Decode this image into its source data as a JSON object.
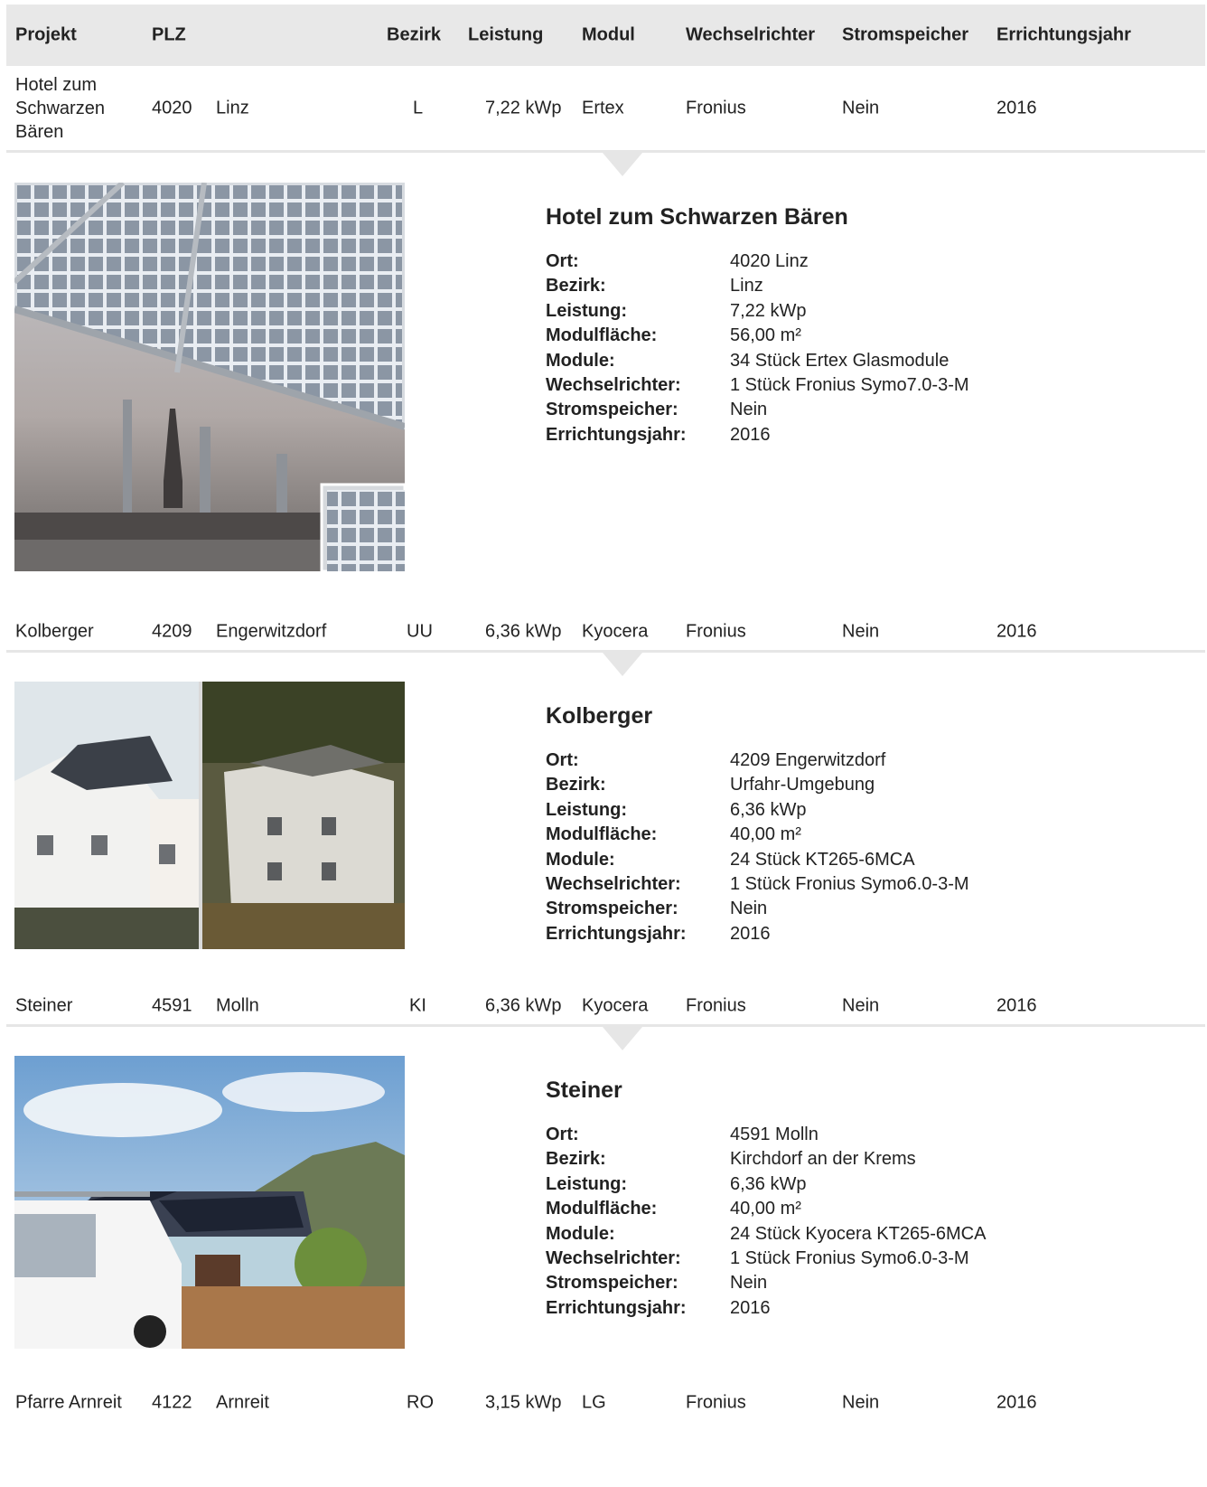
{
  "header": {
    "projekt": "Projekt",
    "plz": "PLZ",
    "bezirk": "Bezirk",
    "leistung": "Leistung",
    "modul": "Modul",
    "wechselrichter": "Wechselrichter",
    "stromspeicher": "Stromspeicher",
    "errichtungsjahr": "Errichtungsjahr"
  },
  "labels": {
    "ort": "Ort:",
    "bezirk": "Bezirk:",
    "leistung": "Leistung:",
    "modulflaeche": "Modulfläche:",
    "module": "Module:",
    "wechselrichter": "Wechselrichter:",
    "stromspeicher": "Stromspeicher:",
    "errichtungsjahr": "Errichtungsjahr:"
  },
  "projects": [
    {
      "name": "Hotel zum Schwarzen Bären",
      "plz": "4020",
      "ort": "Linz",
      "bezirk_code": "L",
      "leistung": "7,22 kWp",
      "modul": "Ertex",
      "wechselrichter": "Fronius",
      "stromspeicher": "Nein",
      "jahr": "2016",
      "detail": {
        "title": "Hotel zum Schwarzen Bären",
        "ort": "4020 Linz",
        "bezirk": "Linz",
        "leistung": "7,22 kWp",
        "modulflaeche": "56,00 m²",
        "module": "34 Stück Ertex Glasmodule",
        "wechselrichter": "1 Stück Fronius Symo7.0-3-M",
        "stromspeicher": "Nein",
        "errichtungsjahr": "2016"
      }
    },
    {
      "name": "Kolberger",
      "plz": "4209",
      "ort": "Engerwitzdorf",
      "bezirk_code": "UU",
      "leistung": "6,36 kWp",
      "modul": "Kyocera",
      "wechselrichter": "Fronius",
      "stromspeicher": "Nein",
      "jahr": "2016",
      "detail": {
        "title": "Kolberger",
        "ort": "4209 Engerwitzdorf",
        "bezirk": "Urfahr-Umgebung",
        "leistung": "6,36 kWp",
        "modulflaeche": "40,00 m²",
        "module": "24 Stück KT265-6MCA",
        "wechselrichter": "1 Stück Fronius Symo6.0-3-M",
        "stromspeicher": "Nein",
        "errichtungsjahr": "2016"
      }
    },
    {
      "name": "Steiner",
      "plz": "4591",
      "ort": "Molln",
      "bezirk_code": "KI",
      "leistung": "6,36 kWp",
      "modul": "Kyocera",
      "wechselrichter": "Fronius",
      "stromspeicher": "Nein",
      "jahr": "2016",
      "detail": {
        "title": "Steiner",
        "ort": "4591 Molln",
        "bezirk": "Kirchdorf an der Krems",
        "leistung": "6,36 kWp",
        "modulflaeche": "40,00 m²",
        "module": "24 Stück Kyocera KT265-6MCA",
        "wechselrichter": "1 Stück Fronius Symo6.0-3-M",
        "stromspeicher": "Nein",
        "errichtungsjahr": "2016"
      }
    },
    {
      "name": "Pfarre Arnreit",
      "plz": "4122",
      "ort": "Arnreit",
      "bezirk_code": "RO",
      "leistung": "3,15 kWp",
      "modul": "LG",
      "wechselrichter": "Fronius",
      "stromspeicher": "Nein",
      "jahr": "2016"
    }
  ]
}
